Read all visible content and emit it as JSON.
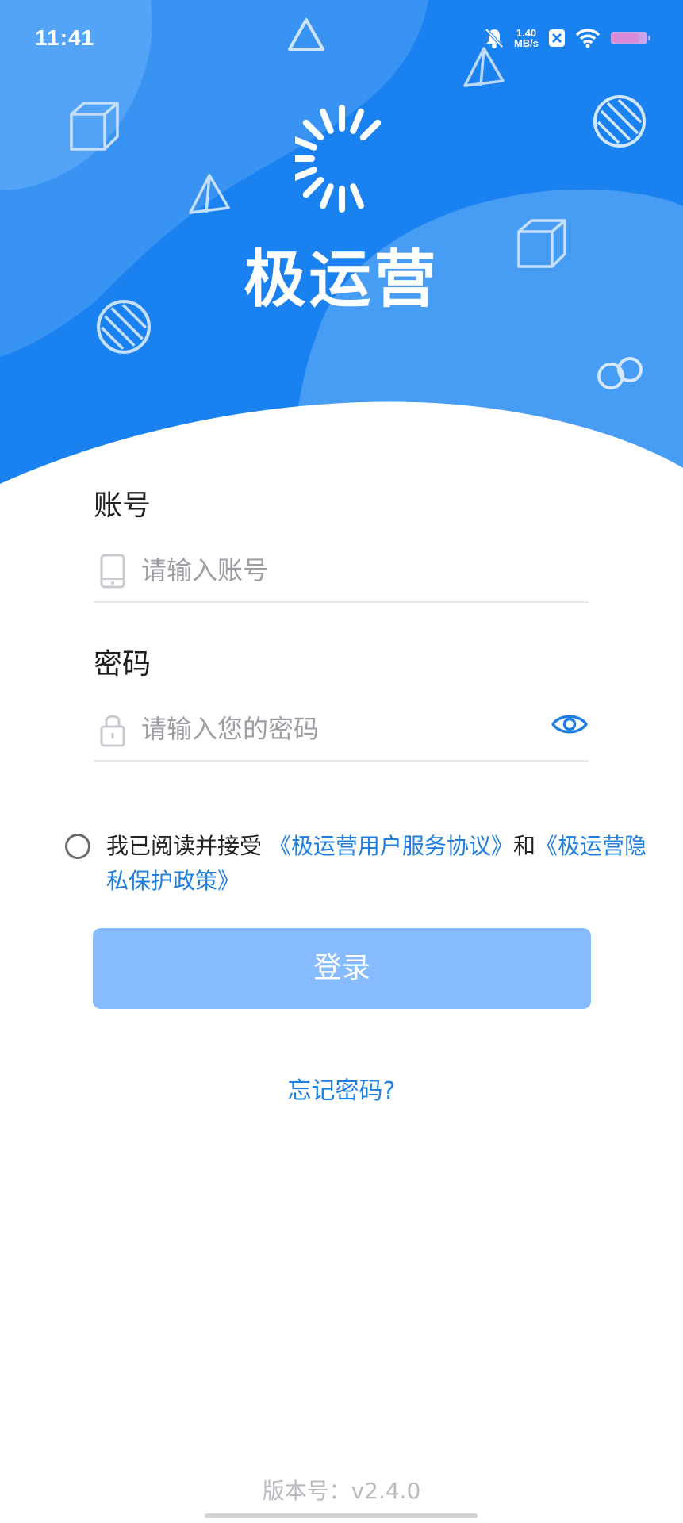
{
  "status_bar": {
    "time": "11:41",
    "net_speed_value": "1.40",
    "net_speed_unit": "MB/s",
    "icons": [
      "bell-muted-icon",
      "close-box-icon",
      "wifi-icon",
      "battery-icon"
    ]
  },
  "app": {
    "name": "极运营"
  },
  "form": {
    "account_label": "账号",
    "account_placeholder": "请输入账号",
    "password_label": "密码",
    "password_placeholder": "请输入您的密码"
  },
  "agreement": {
    "prefix": "我已阅读并接受",
    "terms_link": "《极运营用户服务协议》",
    "conjunction": "和",
    "privacy_link": "《极运营隐私保护政策》"
  },
  "login_button": "登录",
  "forgot_password": "忘记密码?",
  "version": "版本号：v2.4.0",
  "colors": {
    "header_blue": "#1a82f0",
    "link_blue": "#1f7ee0",
    "button_disabled": "#86bcff"
  }
}
